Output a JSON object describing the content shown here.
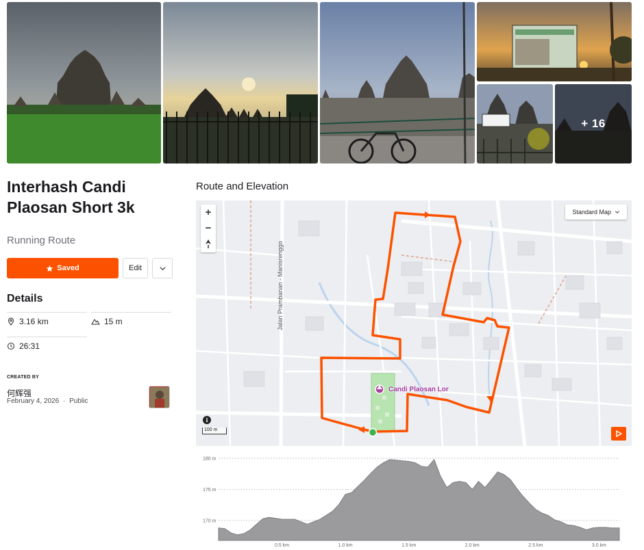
{
  "photos": {
    "more_label": "+ 16"
  },
  "route": {
    "title": "Interhash Candi Plaosan Short 3k",
    "type": "Running Route"
  },
  "actions": {
    "saved_label": "Saved",
    "edit_label": "Edit"
  },
  "details": {
    "title": "Details",
    "distance": "3.16 km",
    "elevation_gain": "15 m",
    "est_time": "26:31"
  },
  "creator": {
    "section_label": "CREATED BY",
    "name": "何辉强",
    "date": "February 4, 2026",
    "visibility": "Public",
    "separator": "·"
  },
  "map": {
    "section_title": "Route and Elevation",
    "map_type": "Standard Map",
    "zoom_in": "+",
    "zoom_out": "−",
    "info": "i",
    "scale": "100 m",
    "road_label": "Jalan Prambanan - Manisrenggo",
    "poi_label": "Candi Plaosan Lor",
    "route_color": "#fc5200"
  },
  "chart_data": {
    "type": "area",
    "xlabel": "",
    "ylabel": "",
    "x_ticks": [
      "0.5 km",
      "1.0 km",
      "1.5 km",
      "2.0 km",
      "2.5 km",
      "3.0 km"
    ],
    "y_ticks": [
      "170 m",
      "175 m",
      "180 m"
    ],
    "xlim": [
      0,
      3.16
    ],
    "ylim": [
      166.8,
      181.2
    ],
    "x": [
      0,
      0.05,
      0.1,
      0.15,
      0.2,
      0.25,
      0.3,
      0.35,
      0.4,
      0.5,
      0.6,
      0.7,
      0.8,
      0.9,
      0.95,
      1.0,
      1.05,
      1.1,
      1.15,
      1.2,
      1.25,
      1.3,
      1.35,
      1.4,
      1.45,
      1.5,
      1.55,
      1.6,
      1.65,
      1.7,
      1.75,
      1.8,
      1.85,
      1.9,
      1.95,
      2.0,
      2.05,
      2.1,
      2.15,
      2.2,
      2.25,
      2.3,
      2.35,
      2.4,
      2.45,
      2.5,
      2.55,
      2.6,
      2.65,
      2.7,
      2.75,
      2.8,
      2.85,
      2.9,
      2.95,
      3.0,
      3.05,
      3.1,
      3.16
    ],
    "y": [
      168.8,
      168.7,
      168.0,
      167.7,
      167.9,
      168.5,
      169.4,
      170.3,
      170.5,
      170.2,
      170.2,
      169.4,
      170.2,
      171.5,
      172.6,
      174.2,
      174.5,
      175.5,
      176.5,
      177.6,
      178.6,
      179.3,
      179.8,
      179.7,
      179.6,
      179.5,
      179.3,
      178.7,
      178.6,
      179.8,
      177.1,
      175.3,
      176.1,
      176.3,
      176.1,
      175.0,
      176.3,
      175.3,
      176.5,
      177.8,
      177.4,
      176.6,
      175.2,
      173.9,
      172.8,
      171.8,
      171.2,
      170.8,
      170.1,
      169.8,
      169.3,
      169.2,
      168.9,
      168.5,
      168.8,
      168.9,
      168.9,
      168.8,
      168.8
    ]
  }
}
